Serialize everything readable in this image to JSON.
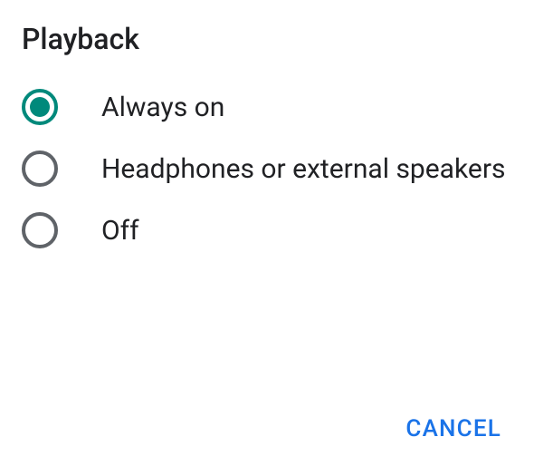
{
  "dialog": {
    "title": "Playback",
    "options": [
      {
        "label": "Always on",
        "selected": true
      },
      {
        "label": "Headphones or external speakers",
        "selected": false
      },
      {
        "label": "Off",
        "selected": false
      }
    ],
    "cancel_label": "CANCEL"
  }
}
